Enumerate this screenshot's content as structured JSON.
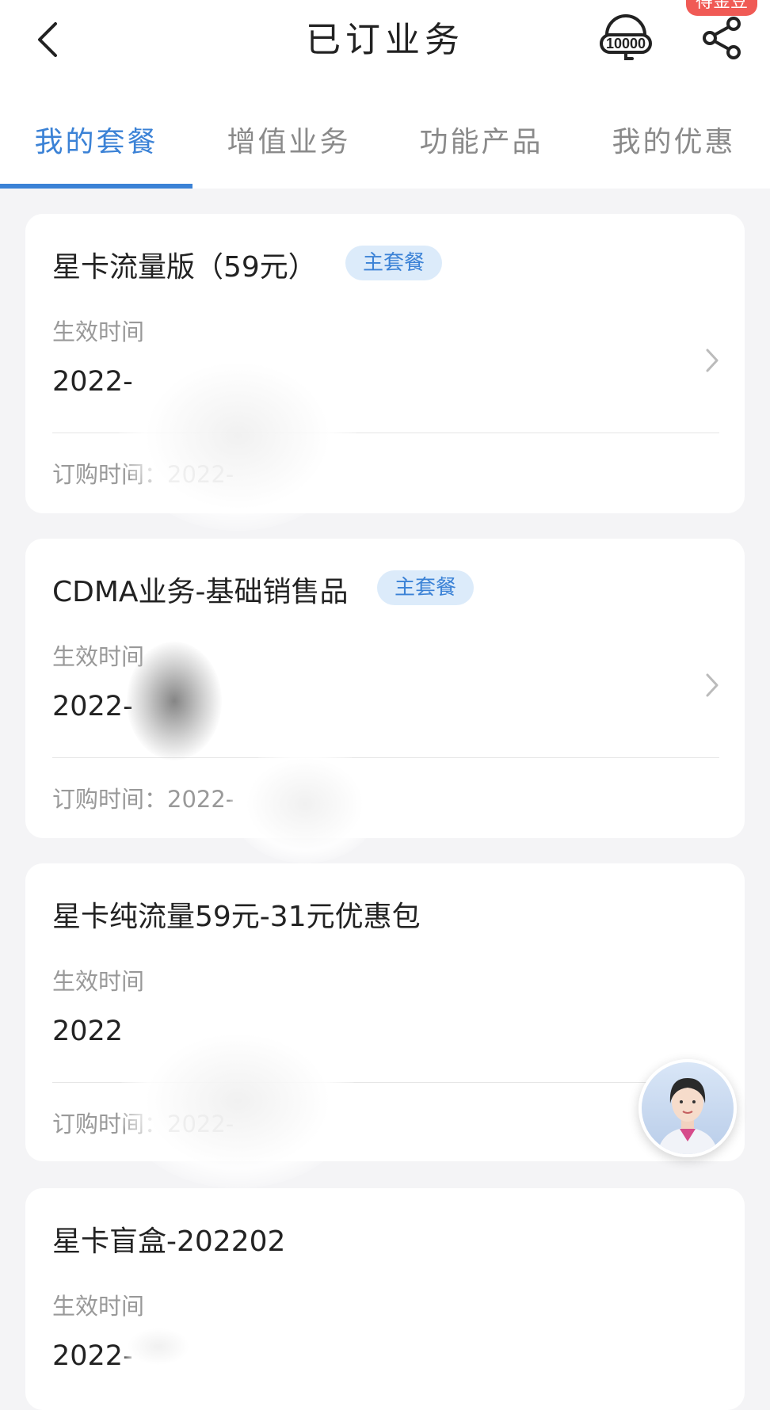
{
  "header": {
    "title": "已订业务",
    "badge": "得金豆",
    "icons": [
      "back-icon",
      "hotline-10000-icon",
      "share-icon"
    ],
    "hotline_text": "10000"
  },
  "tabs": [
    {
      "label": "我的套餐",
      "active": true
    },
    {
      "label": "增值业务",
      "active": false
    },
    {
      "label": "功能产品",
      "active": false
    },
    {
      "label": "我的优惠",
      "active": false
    }
  ],
  "packages": [
    {
      "name": "星卡流量版（59元）",
      "badge": "主套餐",
      "effective_label": "生效时间",
      "effective_value": "2022-",
      "order_text": "订购时间：2022-"
    },
    {
      "name": "CDMA业务-基础销售品",
      "badge": "主套餐",
      "effective_label": "生效时间",
      "effective_value": "2022-",
      "order_text": "订购时间：2022-"
    },
    {
      "name": "星卡纯流量59元-31元优惠包",
      "effective_label": "生效时间",
      "effective_value": "2022",
      "order_text": "订购时间：2022-"
    },
    {
      "name": "星卡盲盒-202202",
      "effective_label": "生效时间",
      "effective_value": "2022-"
    }
  ],
  "colors": {
    "accent": "#3b82d6",
    "badge_bg": "#dcebfa",
    "page_bg": "#f4f4f6",
    "red_badge": "#f05a55"
  }
}
